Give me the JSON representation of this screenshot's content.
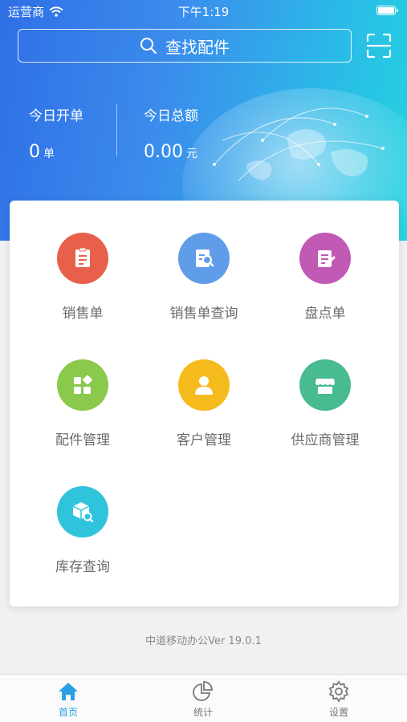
{
  "status_bar": {
    "carrier": "运营商",
    "time": "下午1:19"
  },
  "search": {
    "placeholder": "查找配件"
  },
  "stats": [
    {
      "label": "今日开单",
      "value": "0",
      "unit": "单"
    },
    {
      "label": "今日总额",
      "value": "0.00",
      "unit": "元"
    }
  ],
  "menu": [
    {
      "label": "销售单",
      "icon": "sales-order-icon",
      "color": "#e9604a"
    },
    {
      "label": "销售单查询",
      "icon": "sales-query-icon",
      "color": "#5f9de8"
    },
    {
      "label": "盘点单",
      "icon": "inventory-count-icon",
      "color": "#c05ab5"
    },
    {
      "label": "配件管理",
      "icon": "parts-management-icon",
      "color": "#8bc94d"
    },
    {
      "label": "客户管理",
      "icon": "customer-icon",
      "color": "#f5bb1c"
    },
    {
      "label": "供应商管理",
      "icon": "supplier-store-icon",
      "color": "#49bb90"
    },
    {
      "label": "库存查询",
      "icon": "stock-query-icon",
      "color": "#2fc4dc"
    }
  ],
  "version": "中道移动办公Ver 19.0.1",
  "tabs": [
    {
      "label": "首页",
      "icon": "home-icon",
      "active": true
    },
    {
      "label": "统计",
      "icon": "pie-chart-icon",
      "active": false
    },
    {
      "label": "设置",
      "icon": "gear-icon",
      "active": false
    }
  ],
  "colors": {
    "accent": "#2a9fe3",
    "hero_start": "#2f6fe6",
    "hero_end": "#22d3e0"
  }
}
